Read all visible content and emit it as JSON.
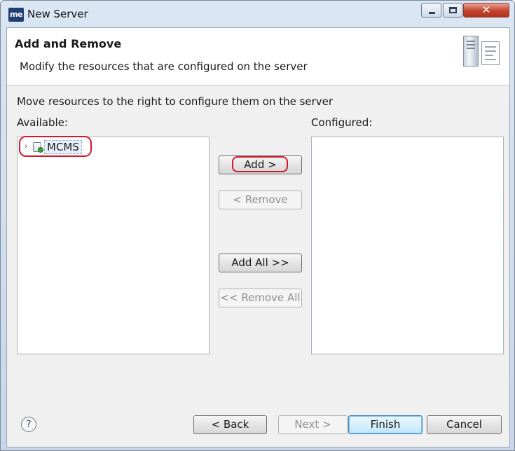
{
  "window": {
    "title": "New Server",
    "app_icon_text": "me"
  },
  "header": {
    "title": "Add and Remove",
    "description": "Modify the resources that are configured on the server"
  },
  "body": {
    "instruction": "Move resources to the right to configure them on the server",
    "available_label": "Available:",
    "configured_label": "Configured:",
    "available_items": [
      {
        "label": "MCMS",
        "icon": "project-icon"
      }
    ],
    "configured_items": []
  },
  "buttons": {
    "add": "Add >",
    "remove": "< Remove",
    "add_all": "Add All >>",
    "remove_all": "<< Remove All"
  },
  "footer": {
    "back": "< Back",
    "next": "Next >",
    "finish": "Finish",
    "cancel": "Cancel",
    "help_icon": "?"
  },
  "colors": {
    "highlight": "#d0182a",
    "default_button_border": "#3c7fb1"
  }
}
